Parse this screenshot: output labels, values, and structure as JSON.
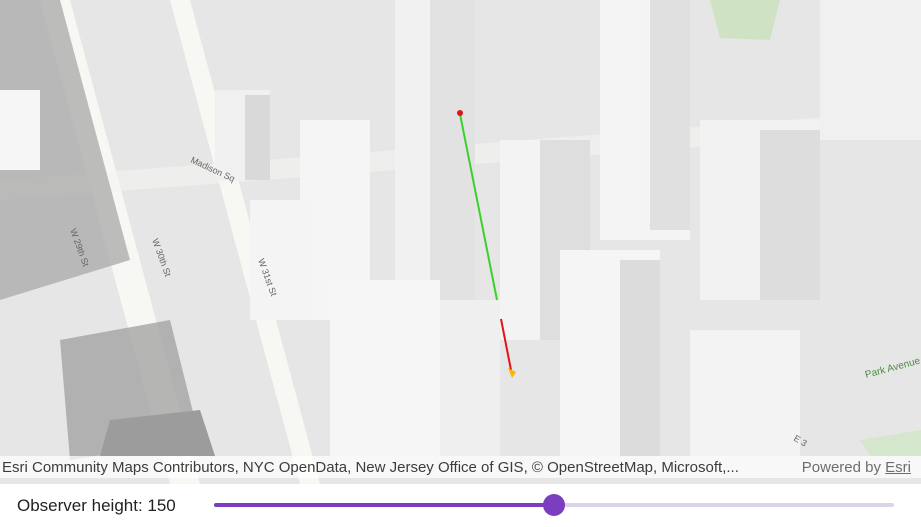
{
  "map": {
    "street_labels": [
      "W 29th St",
      "W 30th St",
      "W 31st St",
      "Madison Sq",
      "Park Avenue Malls",
      "E 3"
    ],
    "colors": {
      "sky_base": "#ececec",
      "building": "#f3f3f3",
      "building_shade": "#d9d9d9",
      "dark_roof": "#9e9e9e",
      "park": "#cfe3c4",
      "visible_line": "#3ad12f",
      "hidden_line": "#e0141e",
      "observer": "#e0141e",
      "target": "#f2b900"
    }
  },
  "attribution": {
    "credits": "Esri Community Maps Contributors, NYC OpenData, New Jersey Office of GIS, © OpenStreetMap, Microsoft,...",
    "powered_prefix": "Powered by ",
    "powered_link": "Esri"
  },
  "controls": {
    "label": "Observer height: 150",
    "slider": {
      "value": 150,
      "min": 0,
      "max": 300,
      "accent": "#7b3ebf"
    }
  }
}
